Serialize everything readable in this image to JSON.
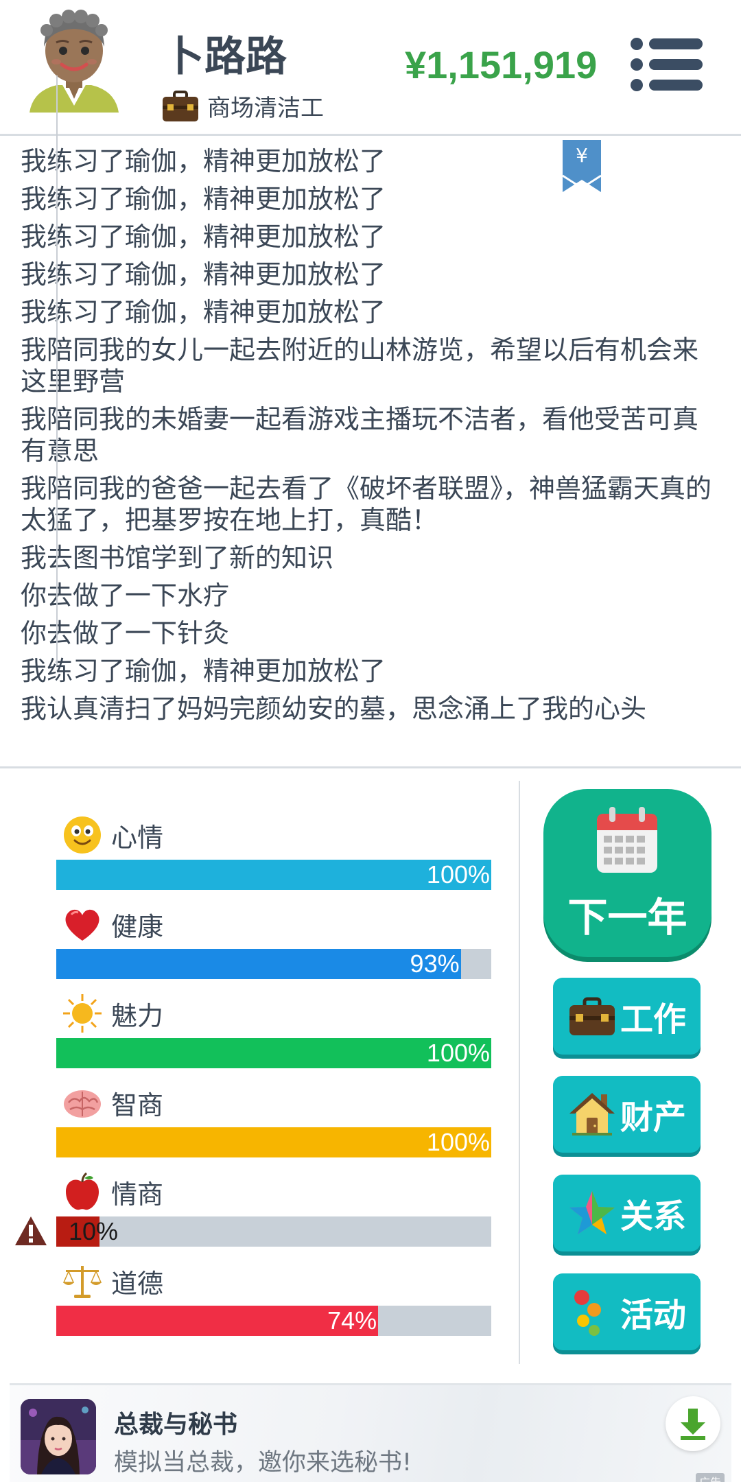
{
  "header": {
    "name": "卜路路",
    "job": "商场清洁工",
    "money": "¥1,151,919"
  },
  "log": {
    "entries": [
      "我练习了瑜伽，精神更加放松了",
      "我练习了瑜伽，精神更加放松了",
      "我练习了瑜伽，精神更加放松了",
      "我练习了瑜伽，精神更加放松了",
      "我练习了瑜伽，精神更加放松了",
      "我陪同我的女儿一起去附近的山林游览，希望以后有机会来这里野营",
      "我陪同我的未婚妻一起看游戏主播玩不洁者，看他受苦可真有意思",
      "我陪同我的爸爸一起去看了《破坏者联盟》，神兽猛霸天真的太猛了，把基罗按在地上打，真酷！",
      "我去图书馆学到了新的知识",
      "你去做了一下水疗",
      "你去做了一下针灸",
      "我练习了瑜伽，精神更加放松了",
      "我认真清扫了妈妈完颜幼安的墓，思念涌上了我的心头"
    ]
  },
  "stats": [
    {
      "label": "心情",
      "value": "100%",
      "fraction": 1.0,
      "color": "#1eb1dc",
      "icon": "smiley-icon"
    },
    {
      "label": "健康",
      "value": "93%",
      "fraction": 0.93,
      "color": "#1a8ae6",
      "icon": "heart-icon"
    },
    {
      "label": "魅力",
      "value": "100%",
      "fraction": 1.0,
      "color": "#12c05a",
      "icon": "sun-icon"
    },
    {
      "label": "智商",
      "value": "100%",
      "fraction": 1.0,
      "color": "#f7b500",
      "icon": "brain-icon"
    },
    {
      "label": "情商",
      "value": "10%",
      "fraction": 0.1,
      "color": "#b81c12",
      "icon": "apple-icon",
      "warning": true
    },
    {
      "label": "道德",
      "value": "74%",
      "fraction": 0.74,
      "color": "#f02e45",
      "icon": "scales-icon"
    }
  ],
  "actions": {
    "next_year": "下一年",
    "work": "工作",
    "property": "财产",
    "relations": "关系",
    "activities": "活动"
  },
  "ad": {
    "title": "总裁与秘书",
    "subtitle": "模拟当总裁，邀你来选秘书!",
    "tag": "广告"
  },
  "colors": {
    "money": "#3aa34a",
    "text": "#3b4756",
    "next_year_bg": "#11b38c",
    "action_bg": "#12bcc2"
  }
}
